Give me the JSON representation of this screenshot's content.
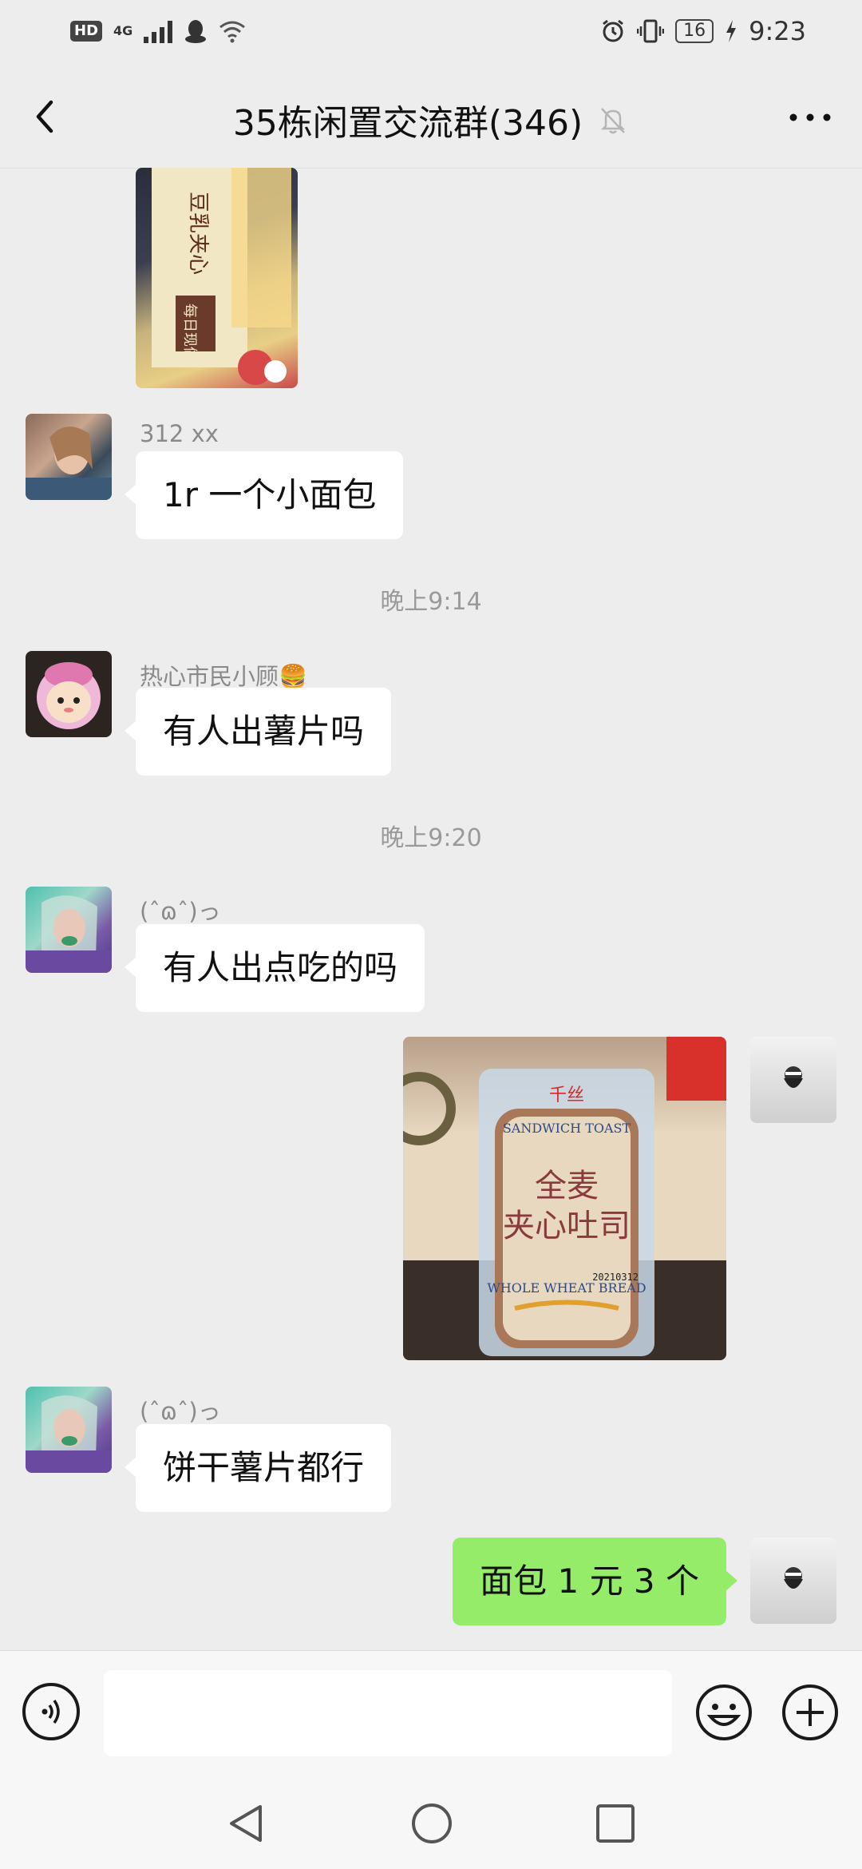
{
  "status_bar": {
    "hd": "HD",
    "network": "4G",
    "time": "9:23",
    "battery": "16"
  },
  "header": {
    "title": "35栋闲置交流群(346)",
    "back_icon": "chevron-left-icon",
    "mute_icon": "bell-off-icon",
    "more_icon": "more-dots-icon"
  },
  "messages": [
    {
      "type": "image",
      "side": "left",
      "description_icon": "snack-photo"
    },
    {
      "type": "text",
      "side": "left",
      "sender": "312 xx",
      "text": "1r 一个小面包"
    },
    {
      "type": "time",
      "text": "晚上9:14"
    },
    {
      "type": "text",
      "side": "left",
      "sender": "热心市民小顾🍔",
      "text": "有人出薯片吗"
    },
    {
      "type": "time",
      "text": "晚上9:20"
    },
    {
      "type": "text",
      "side": "left",
      "sender": "(ˆɷˆ)っ",
      "text": "有人出点吃的吗"
    },
    {
      "type": "image",
      "side": "right",
      "image_text": {
        "brand": "千丝",
        "top": "SANDWICH TOAST",
        "line1": "全麦",
        "line2": "夹心吐司",
        "bottom": "WHOLE WHEAT BREAD",
        "code": "20210312"
      }
    },
    {
      "type": "text",
      "side": "left",
      "sender": "(ˆɷˆ)っ",
      "text": "饼干薯片都行"
    },
    {
      "type": "text",
      "side": "right",
      "text": "面包 1 元 3 个"
    }
  ],
  "first_image_text": {
    "line1": "豆乳夹心",
    "line2": "每日现做"
  },
  "input": {
    "value": "",
    "voice_icon": "voice-icon",
    "emoji_icon": "emoji-icon",
    "plus_icon": "plus-icon"
  },
  "nav": {
    "back_icon": "nav-back-icon",
    "home_icon": "nav-home-icon",
    "recent_icon": "nav-recent-icon"
  },
  "colors": {
    "bubble_self": "#95ec69",
    "bubble_other": "#ffffff",
    "background": "#ededed"
  }
}
